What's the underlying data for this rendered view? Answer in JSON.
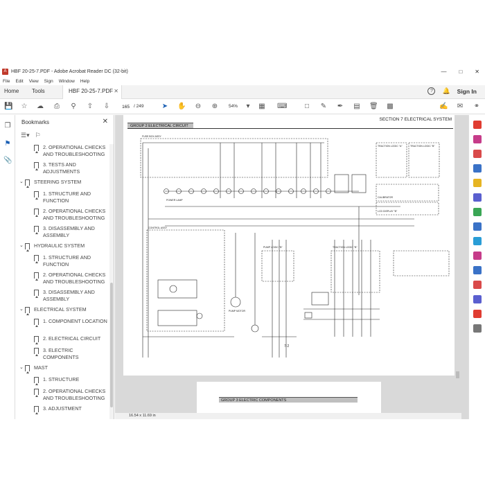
{
  "window": {
    "title": "HBF 20-25-7.PDF - Adobe Acrobat Reader DC (32-bit)"
  },
  "menu": [
    "File",
    "Edit",
    "View",
    "Sign",
    "Window",
    "Help"
  ],
  "tabs": {
    "home": "Home",
    "tools": "Tools",
    "doc": "HBF 20-25-7.PDF",
    "signin": "Sign In"
  },
  "toolbar": {
    "page_current": "165",
    "page_total": "/ 249",
    "zoom": "54%"
  },
  "bookmarks": {
    "title": "Bookmarks",
    "items": [
      {
        "text": "2. OPERATIONAL CHECKS AND TROUBLESHOOTING",
        "level": 2
      },
      {
        "text": "3. TESTS AND ADJUSTMENTS",
        "level": 2
      },
      {
        "text": "STEERING SYSTEM",
        "level": 1
      },
      {
        "text": "1. STRUCTURE AND FUNCTION",
        "level": 2
      },
      {
        "text": "2. OPERATIONAL CHECKS AND TROUBLESHOOTING",
        "level": 2
      },
      {
        "text": "3. DISASSEMBLY AND ASSEMBLY",
        "level": 2
      },
      {
        "text": "HYDRAULIC SYSTEM",
        "level": 1
      },
      {
        "text": "1. STRUCTURE AND FUNCTION",
        "level": 2
      },
      {
        "text": "2. OPERATIONAL CHECKS AND TROUBLESHOOTING",
        "level": 2
      },
      {
        "text": "3. DISASSEMBLY AND ASSEMBLY",
        "level": 2
      },
      {
        "text": "ELECTRICAL SYSTEM",
        "level": 1
      },
      {
        "text": "1. COMPONENT LOCATION",
        "level": 2
      },
      {
        "text": "2. ELECTRICAL CIRCUIT",
        "level": 2
      },
      {
        "text": "3. ELECTRIC COMPONENTS",
        "level": 2
      },
      {
        "text": "MAST",
        "level": 1
      },
      {
        "text": "1. STRUCTURE",
        "level": 2
      },
      {
        "text": "2. OPERATIONAL CHECKS AND TROUBLESHOOTING",
        "level": 2
      },
      {
        "text": "3. ADJUSTMENT",
        "level": 2
      }
    ]
  },
  "document": {
    "section_heading": "SECTION 7  ELECTRICAL  SYSTEM",
    "group_heading": "GROUP  2  ELECTRICAL CIRCUIT",
    "page_number": "7-2",
    "next_group_heading": "GROUP  3  ELECTRIC COMPONENTS",
    "page_size": "16.54 x 11.69 in",
    "schematic_labels": {
      "fuse_box": "FUSE BOX ASSY",
      "control_assy": "CONTROL ASSY",
      "traction_logic_a": "TRACTION LOGIC \"A\"",
      "traction_logic_b": "TRACTION LOGIC \"B\"",
      "pump_logic": "PUMP LOGIC \"B\"",
      "traction_logic": "TRACTION LOGIC \"B\"",
      "power_lamp": "POWER LAMP",
      "pump_motor": "PUMP MOTOR",
      "calibrator": "CALIBRATOR",
      "lcd_display": "LCD DISPLAY \"B\""
    }
  }
}
